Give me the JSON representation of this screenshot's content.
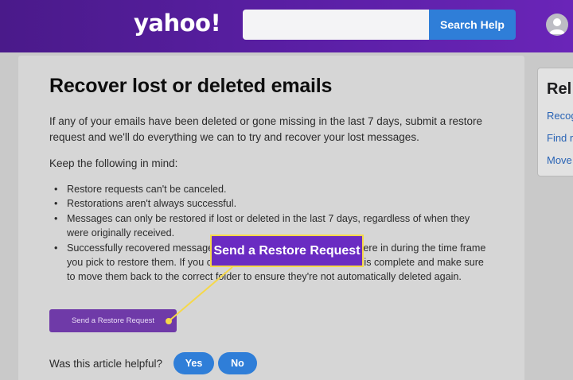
{
  "header": {
    "logo": "yahoo!",
    "search_placeholder": "",
    "search_button": "Search Help"
  },
  "article": {
    "title": "Recover lost or deleted emails",
    "intro": "If any of your emails have been deleted or gone missing in the last 7 days, submit a restore request and we'll do everything we can to try and recover your lost messages.",
    "keep_in_mind": "Keep the following in mind:",
    "bullets": [
      "Restore requests can't be canceled.",
      "Restorations aren't always successful.",
      "Messages can only be restored if lost or deleted in the last 7 days, regardless of when they were originally received.",
      "Successfully recovered messages are returned to the folder they were in during the time frame you pick to restore them. If you can't find them after the restoration is complete and make sure to move them back to the correct folder to ensure they're not automatically deleted again."
    ],
    "restore_button": "Send a Restore Request",
    "helpful_question": "Was this article helpful?",
    "yes_label": "Yes",
    "no_label": "No"
  },
  "callout": {
    "label": "Send a Restore Request",
    "color": "#6a2bc2",
    "border_color": "#f5d84a"
  },
  "side_panel": {
    "title": "Rel",
    "links": [
      "Recog",
      "Find r",
      "Move"
    ]
  },
  "colors": {
    "header": "#5b1fa6",
    "accent_blue": "#2f7ed8",
    "restore_button": "#6f3aa8"
  },
  "icons": {
    "avatar": "user-avatar-icon"
  }
}
